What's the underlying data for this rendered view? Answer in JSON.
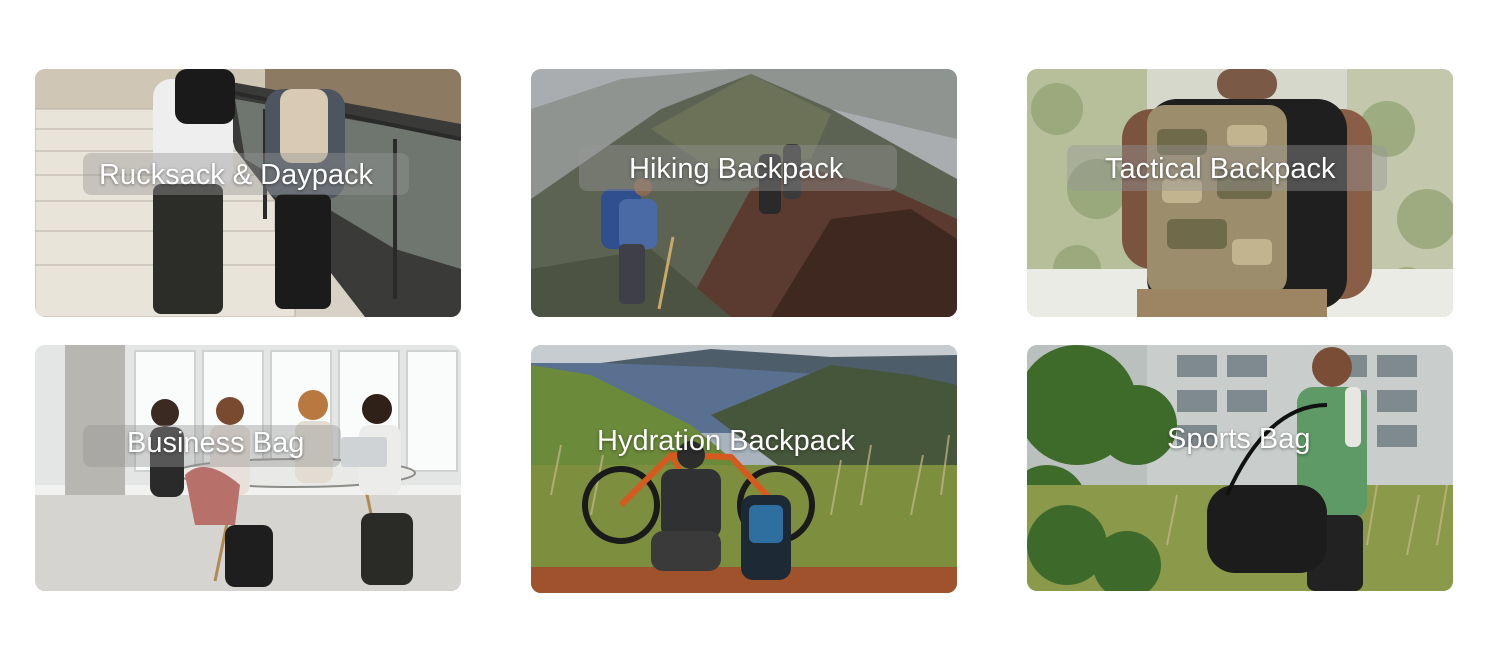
{
  "categories": [
    {
      "label": "Rucksack & Daypack"
    },
    {
      "label": "Hiking Backpack"
    },
    {
      "label": "Tactical Backpack"
    },
    {
      "label": "Business Bag"
    },
    {
      "label": "Hydration Backpack"
    },
    {
      "label": "Sports Bag"
    }
  ]
}
